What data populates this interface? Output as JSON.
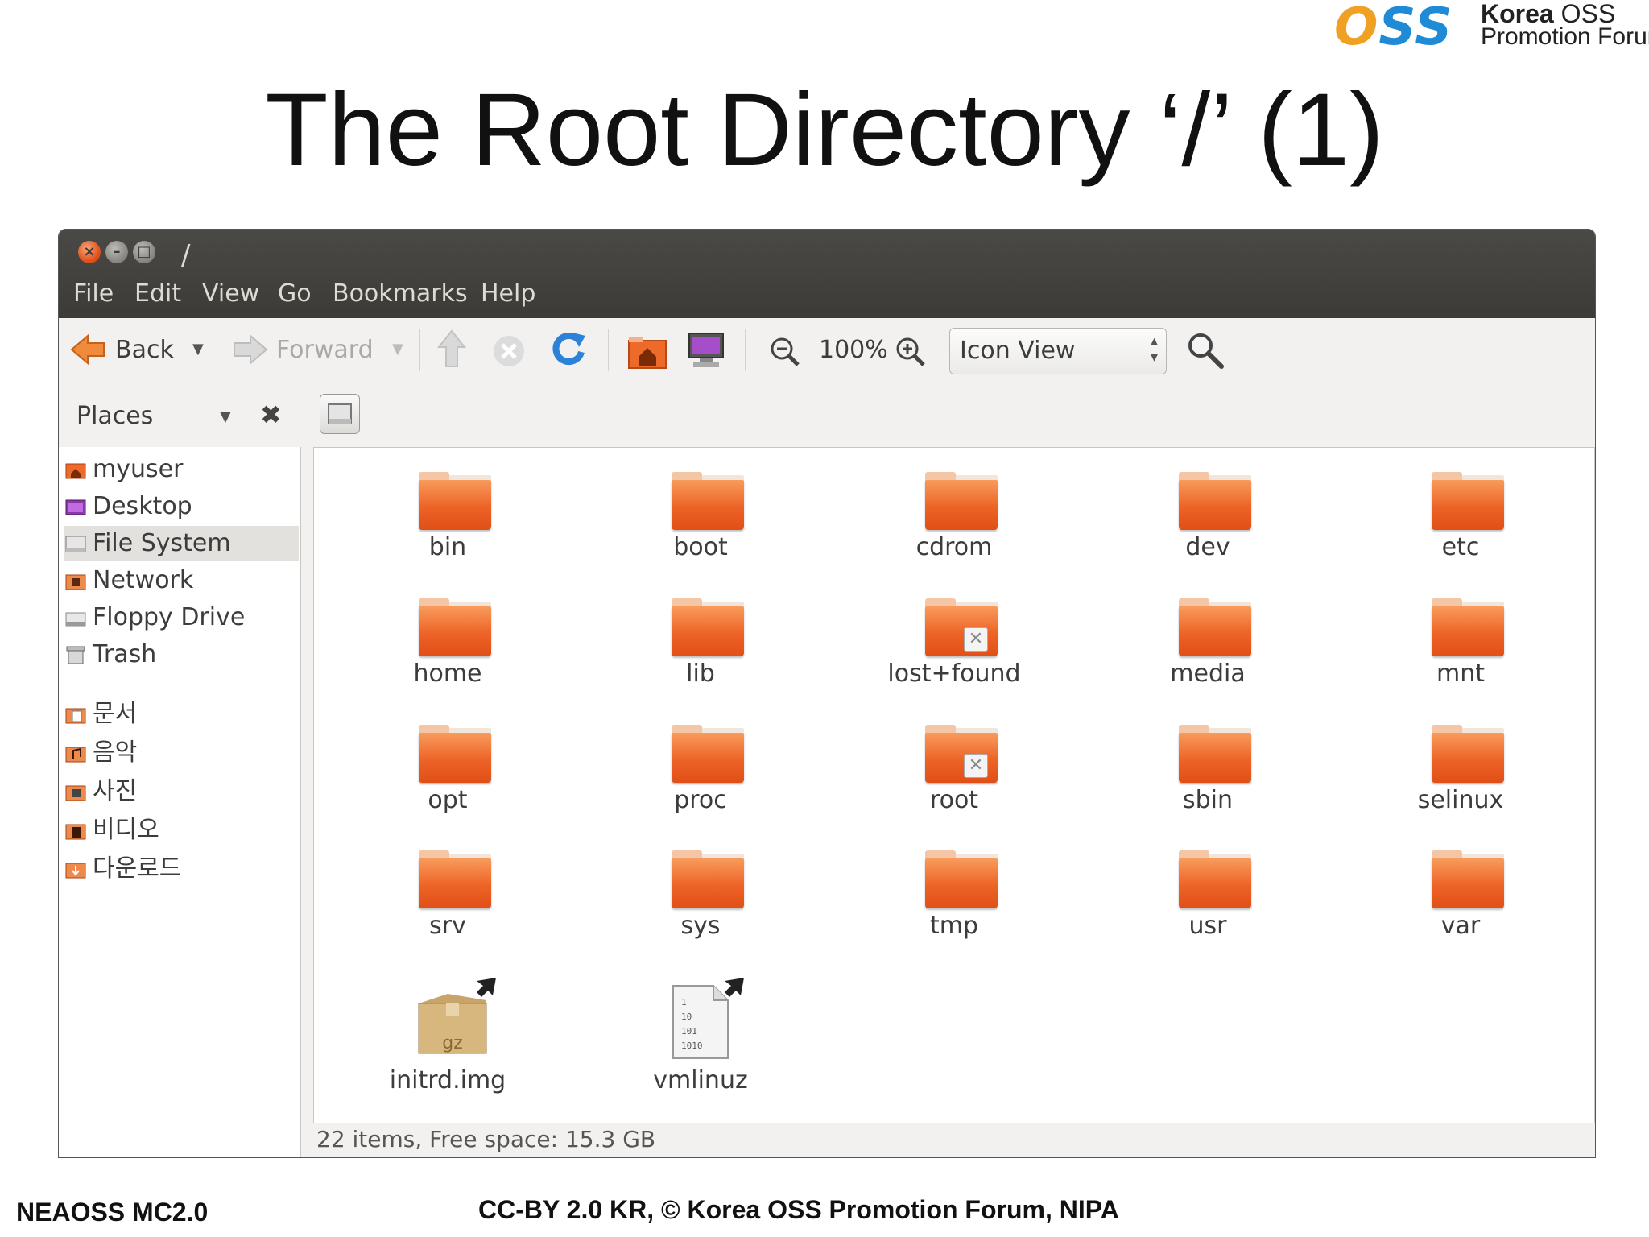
{
  "logo": {
    "mark": "OSS",
    "line1_bold": "Korea",
    "line1_rest": " OSS",
    "line2": "Promotion Forum"
  },
  "slide": {
    "title": "The Root Directory ‘/’ (1)"
  },
  "window": {
    "title": "/"
  },
  "menu": [
    "File",
    "Edit",
    "View",
    "Go",
    "Bookmarks",
    "Help"
  ],
  "toolbar": {
    "back": "Back",
    "forward": "Forward",
    "zoom": "100%",
    "view_mode": "Icon View"
  },
  "places": {
    "label": "Places",
    "items": [
      {
        "label": "myuser",
        "icon": "home-folder-icon"
      },
      {
        "label": "Desktop",
        "icon": "desktop-icon"
      },
      {
        "label": "File System",
        "icon": "drive-icon"
      },
      {
        "label": "Network",
        "icon": "network-icon"
      },
      {
        "label": "Floppy Drive",
        "icon": "floppy-icon"
      },
      {
        "label": "Trash",
        "icon": "trash-icon"
      },
      {
        "label": "문서",
        "icon": "documents-folder-icon"
      },
      {
        "label": "음악",
        "icon": "music-folder-icon"
      },
      {
        "label": "사진",
        "icon": "pictures-folder-icon"
      },
      {
        "label": "비디오",
        "icon": "videos-folder-icon"
      },
      {
        "label": "다운로드",
        "icon": "downloads-folder-icon"
      }
    ]
  },
  "files": [
    {
      "name": "bin",
      "type": "folder"
    },
    {
      "name": "boot",
      "type": "folder"
    },
    {
      "name": "cdrom",
      "type": "folder"
    },
    {
      "name": "dev",
      "type": "folder"
    },
    {
      "name": "etc",
      "type": "folder"
    },
    {
      "name": "home",
      "type": "folder"
    },
    {
      "name": "lib",
      "type": "folder"
    },
    {
      "name": "lost+found",
      "type": "folder-locked"
    },
    {
      "name": "media",
      "type": "folder"
    },
    {
      "name": "mnt",
      "type": "folder"
    },
    {
      "name": "opt",
      "type": "folder"
    },
    {
      "name": "proc",
      "type": "folder"
    },
    {
      "name": "root",
      "type": "folder-locked"
    },
    {
      "name": "sbin",
      "type": "folder"
    },
    {
      "name": "selinux",
      "type": "folder"
    },
    {
      "name": "srv",
      "type": "folder"
    },
    {
      "name": "sys",
      "type": "folder"
    },
    {
      "name": "tmp",
      "type": "folder"
    },
    {
      "name": "usr",
      "type": "folder"
    },
    {
      "name": "var",
      "type": "folder"
    },
    {
      "name": "initrd.img",
      "type": "archive-link",
      "badge": "gz"
    },
    {
      "name": "vmlinuz",
      "type": "binary-link",
      "badge_lines": [
        "1",
        "10",
        "101",
        "1010"
      ]
    }
  ],
  "status": "22 items, Free space: 15.3 GB",
  "footer": {
    "left": "NEAOSS MC2.0",
    "center": "CC-BY 2.0 KR, © Korea OSS Promotion Forum, NIPA"
  },
  "colors": {
    "folder": "#ed6326",
    "titlebar": "#3c3b37",
    "accent_blue": "#1f8ad6"
  }
}
